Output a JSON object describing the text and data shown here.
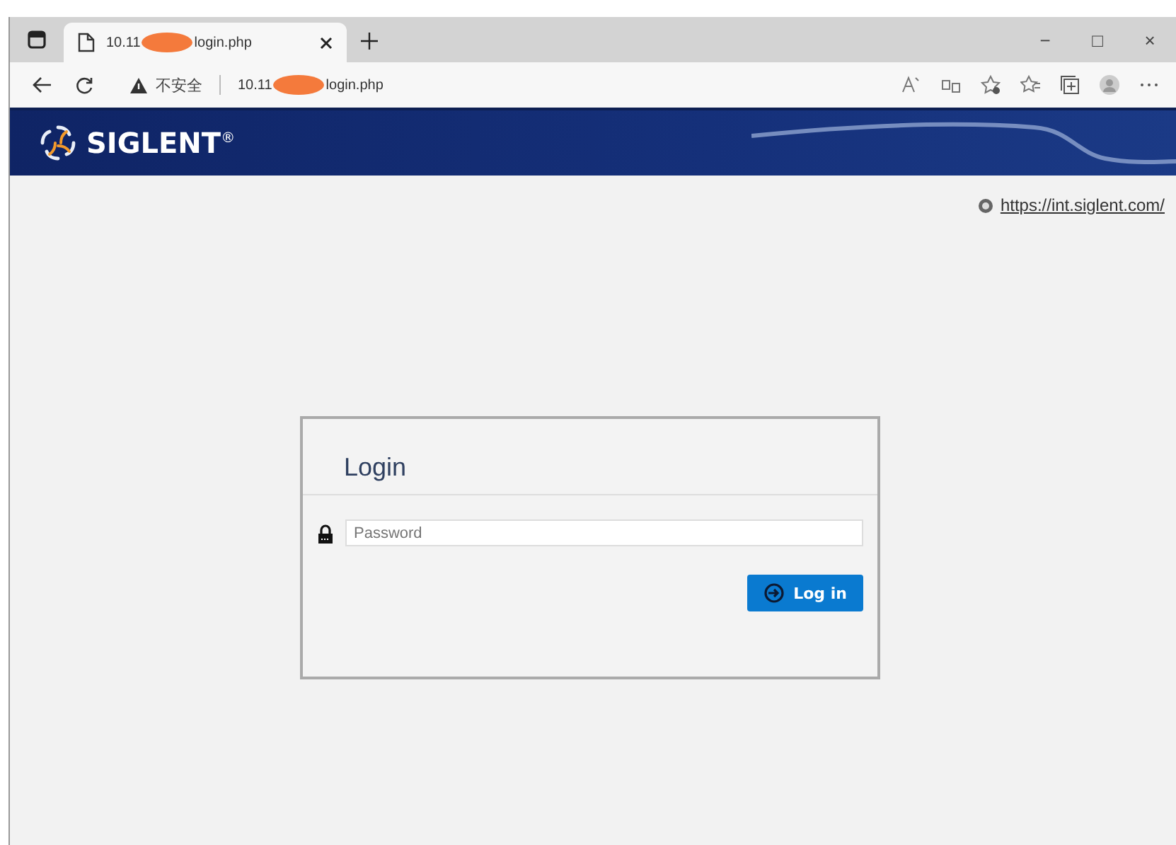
{
  "browser": {
    "tab": {
      "title_start": "10.11",
      "title_end": "login.php",
      "selected": true
    },
    "address": {
      "security": "不安全",
      "url_start": "10.11",
      "url_end": "login.php"
    },
    "window_controls": [
      "−",
      "□",
      "×"
    ]
  },
  "header": {
    "brand": "SIGLENT",
    "mark": "®"
  },
  "site_link": "https://int.siglent.com/",
  "login": {
    "title": "Login",
    "password": {
      "placeholder": "Password"
    },
    "button": "Log in"
  }
}
